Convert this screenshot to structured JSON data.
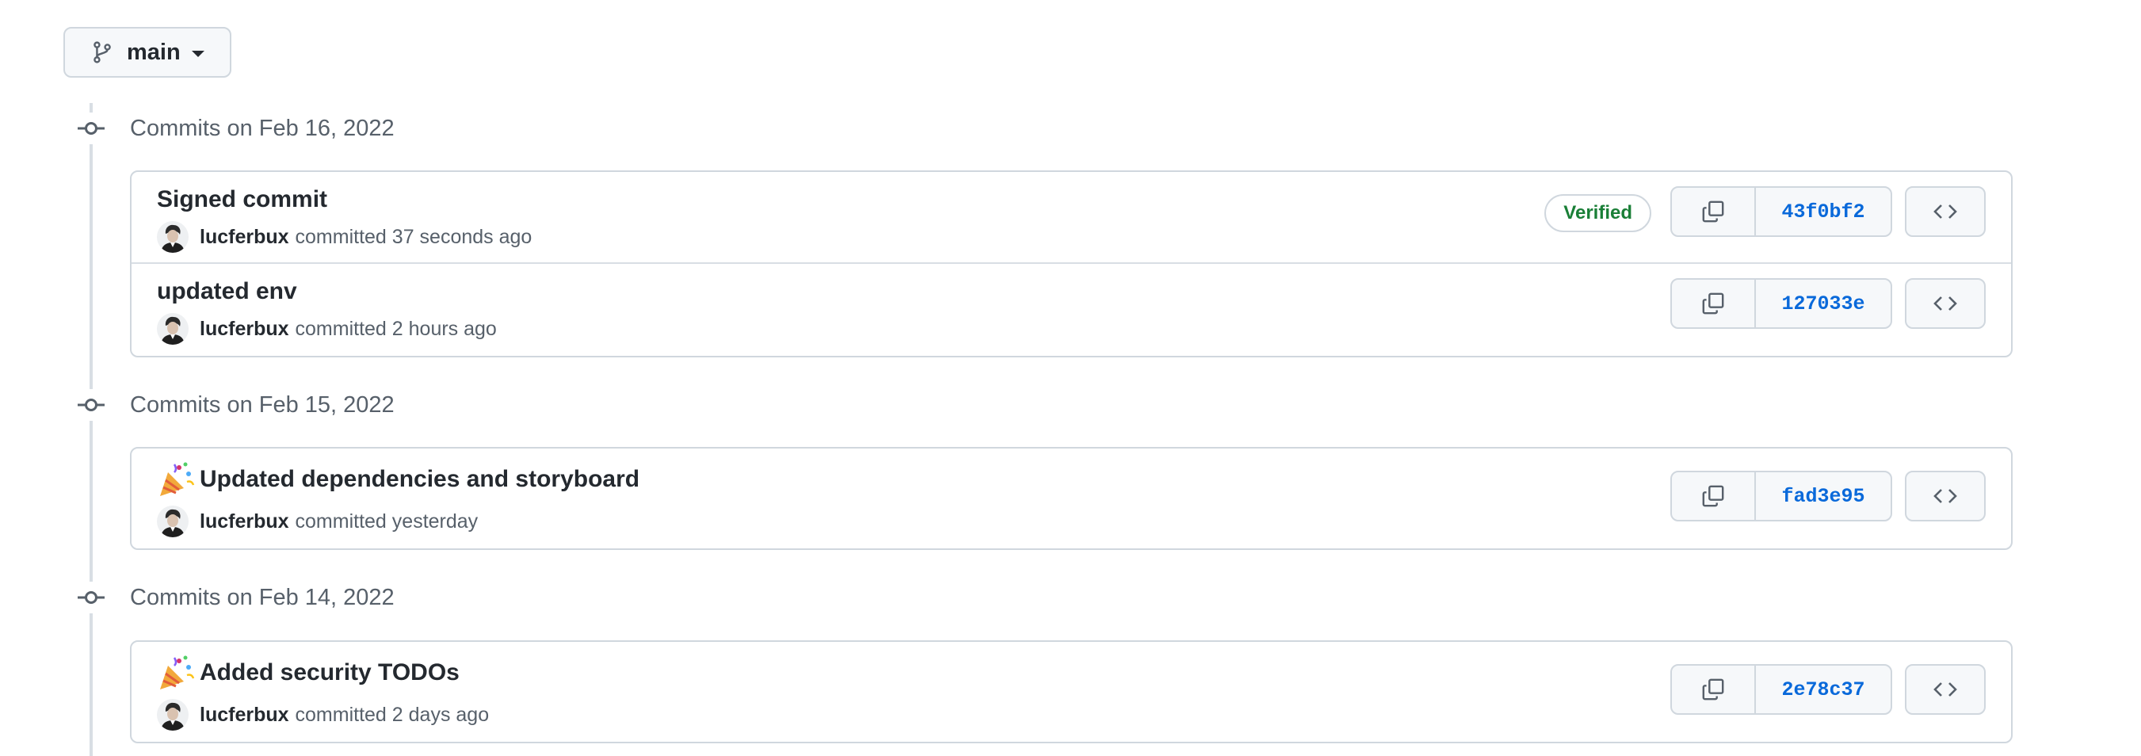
{
  "branch": {
    "name": "main",
    "icon": "git-branch-icon"
  },
  "colors": {
    "link": "#0969da",
    "verified": "#1a7f37",
    "muted": "#57606a",
    "border": "#d0d7de"
  },
  "groups": [
    {
      "title": "Commits on Feb 16, 2022",
      "commits": [
        {
          "title": "Signed commit",
          "emoji": "",
          "author": "lucferbux",
          "action": "committed",
          "time": "37 seconds ago",
          "verified": "Verified",
          "sha": "43f0bf2"
        },
        {
          "title": "updated env",
          "emoji": "",
          "author": "lucferbux",
          "action": "committed",
          "time": "2 hours ago",
          "verified": "",
          "sha": "127033e"
        }
      ]
    },
    {
      "title": "Commits on Feb 15, 2022",
      "commits": [
        {
          "title": "Updated dependencies and storyboard",
          "emoji": "party-popper-icon",
          "author": "lucferbux",
          "action": "committed",
          "time": "yesterday",
          "verified": "",
          "sha": "fad3e95"
        }
      ]
    },
    {
      "title": "Commits on Feb 14, 2022",
      "commits": [
        {
          "title": "Added security TODOs",
          "emoji": "party-popper-icon",
          "author": "lucferbux",
          "action": "committed",
          "time": "2 days ago",
          "verified": "",
          "sha": "2e78c37"
        }
      ]
    }
  ]
}
